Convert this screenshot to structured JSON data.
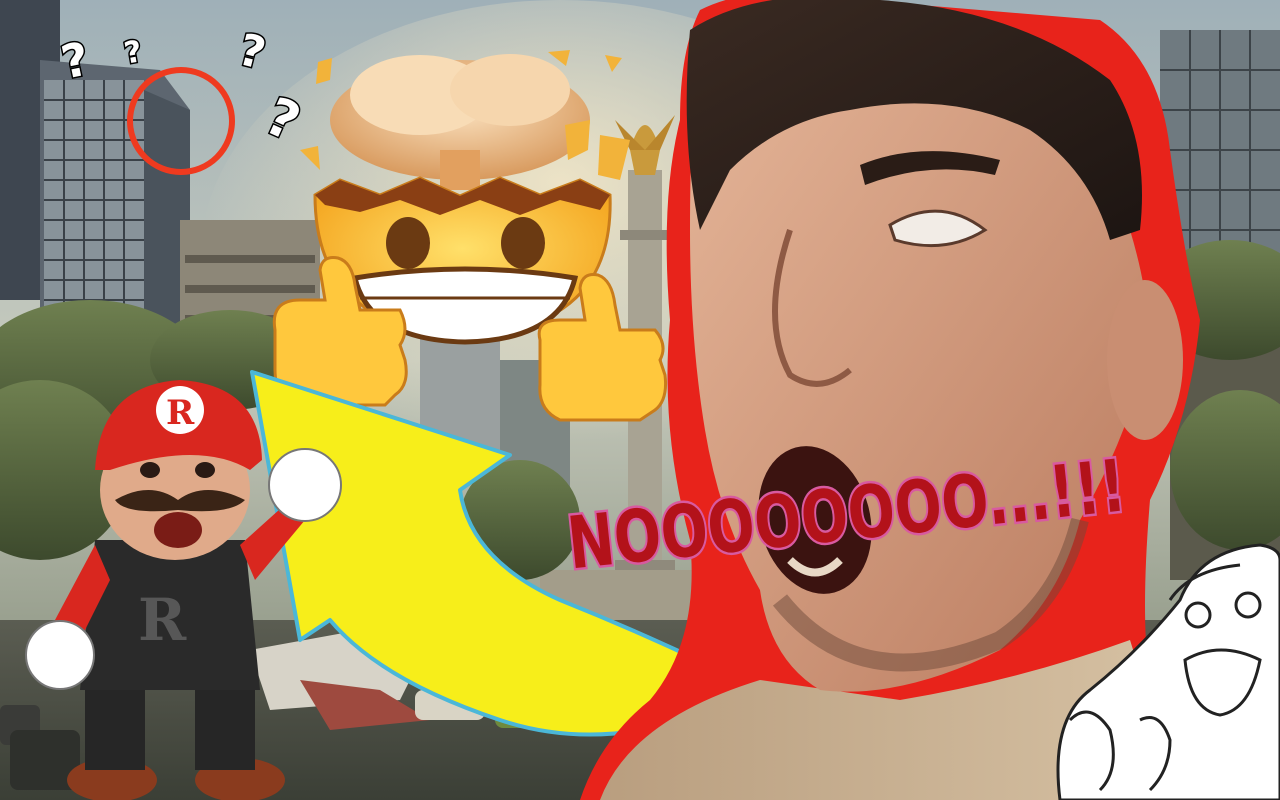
{
  "scene": {
    "kind": "youtube-thumbnail",
    "setting": "ruined city street with skyscrapers and a golden angel monument"
  },
  "texts": {
    "shout": "NOOOOOOOO...!!!",
    "question_marks": [
      "?",
      "?",
      "?",
      "?"
    ],
    "mario_cap_letter": "R",
    "mario_overalls_letter": "R"
  },
  "colors": {
    "outline_red": "#e8231b",
    "arrow_yellow": "#f7ee1a",
    "arrow_outline": "#4bb7d8",
    "circle_red": "#ef3a1f",
    "shout_red": "#b3121a",
    "shout_glow": "#d85aa0",
    "cap_red": "#d9271f",
    "emoji_yellow": "#ffc83d",
    "sky_haze": "#c9cfc3"
  }
}
